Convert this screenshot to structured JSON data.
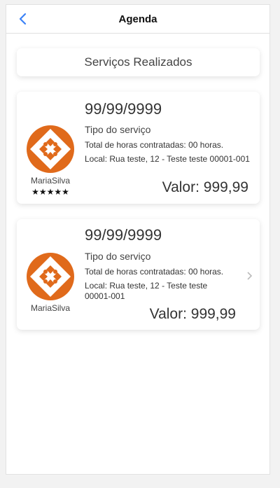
{
  "header": {
    "title": "Agenda",
    "back_icon": "chevron-left-icon"
  },
  "section_title": "Serviços Realizados",
  "colors": {
    "accent": "#3b82f6",
    "logo": "#e06a1b"
  },
  "services": [
    {
      "date": "99/99/9999",
      "type": "Tipo do serviço",
      "hours": "Total de horas contratadas: 00 horas.",
      "location": "Local: Rua teste, 12 - Teste teste 00001-001",
      "value": "Valor: 999,99",
      "provider": "MariaSilva",
      "rating": 5,
      "stars": "★★★★★"
    },
    {
      "date": "99/99/9999",
      "type": "Tipo do serviço",
      "hours": "Total de horas contratadas: 00 horas.",
      "location": "Local: Rua teste, 12 - Teste teste 00001-001",
      "value": "Valor: 999,99",
      "provider": "MariaSilva"
    }
  ]
}
